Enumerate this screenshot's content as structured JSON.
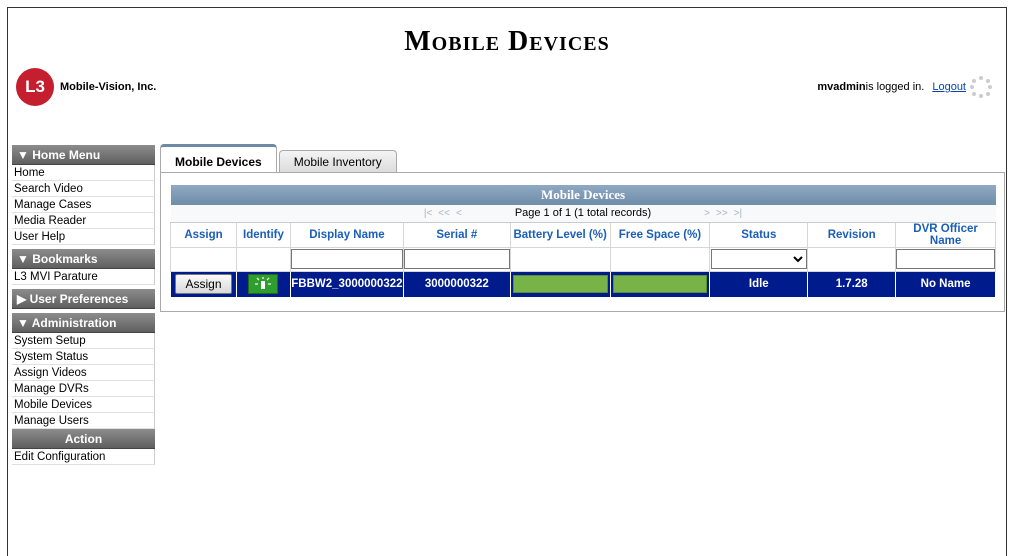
{
  "header": {
    "title": "Mobile Devices",
    "company": "Mobile-Vision, Inc.",
    "logo_mark": "L3",
    "username": "mvadmin",
    "logged_in_text": " is logged in.",
    "logout_label": "Logout"
  },
  "sidebar": {
    "home_menu": {
      "title": "▼ Home Menu",
      "items": [
        "Home",
        "Search Video",
        "Manage Cases",
        "Media Reader",
        "User Help"
      ]
    },
    "bookmarks": {
      "title": "▼ Bookmarks",
      "items": [
        "L3 MVI Parature"
      ]
    },
    "user_preferences": {
      "title": "▶ User Preferences"
    },
    "administration": {
      "title": "▼ Administration",
      "items": [
        "System Setup",
        "System Status",
        "Assign Videos",
        "Manage DVRs",
        "Mobile Devices",
        "Manage Users"
      ]
    },
    "action": {
      "title": "Action",
      "items": [
        "Edit Configuration"
      ]
    }
  },
  "tabs": [
    "Mobile Devices",
    "Mobile Inventory"
  ],
  "grid": {
    "caption": "Mobile Devices",
    "pager": {
      "first": "|<",
      "prev_page": "<<",
      "prev": "<",
      "info": "Page 1 of 1 (1 total records)",
      "next": ">",
      "next_page": ">>",
      "last": ">|"
    },
    "columns": [
      "Assign",
      "Identify",
      "Display Name",
      "Serial #",
      "Battery Level (%)",
      "Free Space (%)",
      "Status",
      "Revision",
      "DVR Officer Name"
    ],
    "rows": [
      {
        "assign_label": "Assign",
        "display_name": "FBBW2_3000000322",
        "serial": "3000000322",
        "battery_level": 1.0,
        "free_space": 1.0,
        "status": "Idle",
        "revision": "1.7.28",
        "officer": "No Name"
      }
    ]
  },
  "colors": {
    "accent_blue": "#001b8c",
    "header_link": "#1a5eb8",
    "logo_red": "#c41e2f",
    "bar_green": "#77b347"
  }
}
